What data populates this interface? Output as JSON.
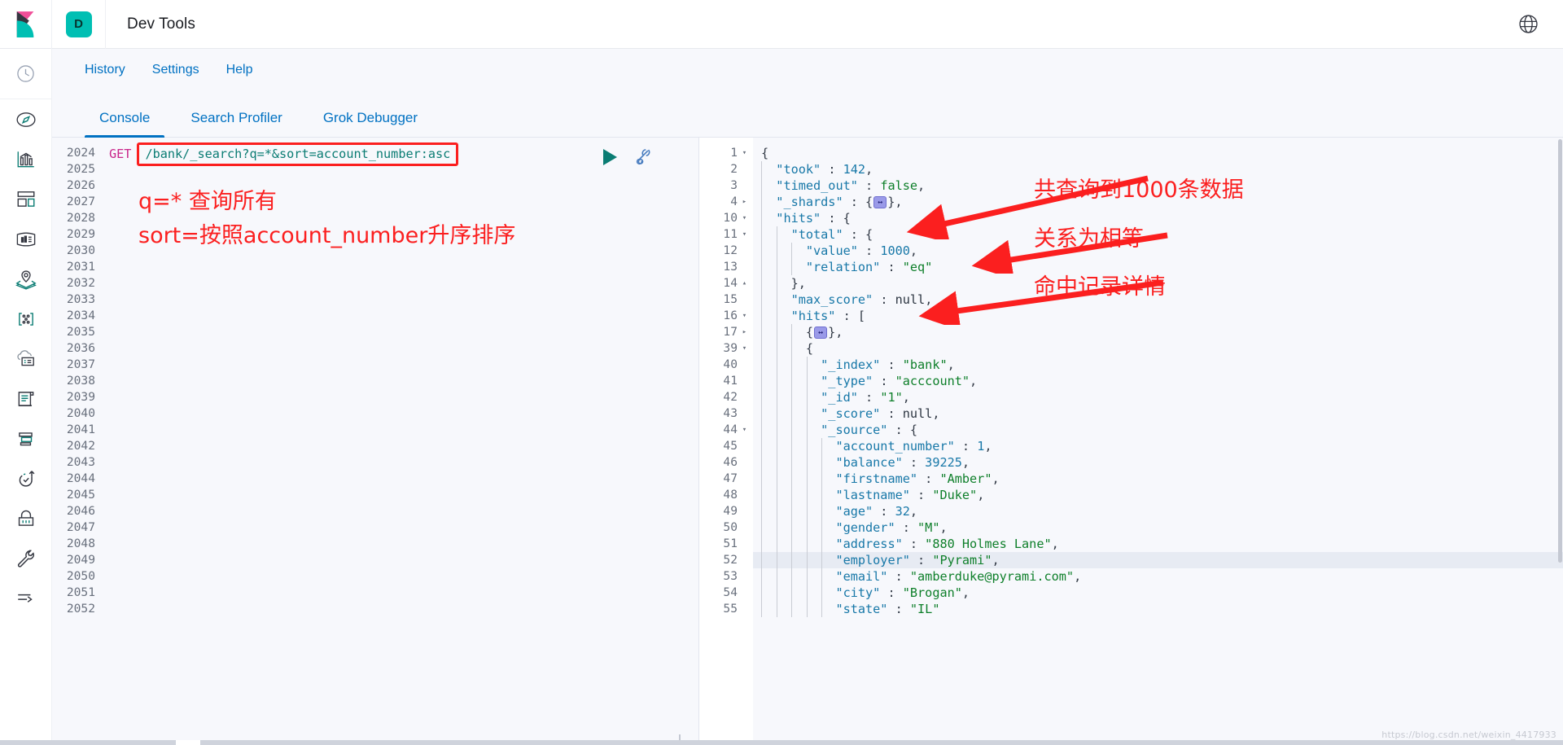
{
  "header": {
    "logo_icon": "kibana-logo",
    "space_letter": "D",
    "title": "Dev Tools",
    "help_icon": "help-circle-icon"
  },
  "sidebar": {
    "items": [
      {
        "icon": "recently-viewed-clock-icon",
        "name": "recently-viewed"
      },
      {
        "icon": "discover-compass-icon",
        "name": "discover"
      },
      {
        "icon": "visualize-chart-icon",
        "name": "visualize"
      },
      {
        "icon": "dashboard-grid-icon",
        "name": "dashboard"
      },
      {
        "icon": "canvas-frame-icon",
        "name": "canvas"
      },
      {
        "icon": "maps-layers-pin-icon",
        "name": "maps"
      },
      {
        "icon": "machine-learning-nodes-icon",
        "name": "machine-learning"
      },
      {
        "icon": "infrastructure-cloud-server-icon",
        "name": "infrastructure"
      },
      {
        "icon": "logs-scroll-icon",
        "name": "logs"
      },
      {
        "icon": "apm-trace-icon",
        "name": "apm"
      },
      {
        "icon": "uptime-check-arrow-icon",
        "name": "uptime"
      },
      {
        "icon": "siem-lock-icon",
        "name": "siem"
      },
      {
        "icon": "dev-tools-wrench-icon",
        "name": "dev-tools"
      },
      {
        "icon": "collapse-arrow-icon",
        "name": "collapse-nav"
      }
    ]
  },
  "topnav": {
    "items": [
      {
        "label": "History",
        "name": "history"
      },
      {
        "label": "Settings",
        "name": "settings"
      },
      {
        "label": "Help",
        "name": "help"
      }
    ]
  },
  "tabs": [
    {
      "label": "Console",
      "active": true
    },
    {
      "label": "Search Profiler",
      "active": false
    },
    {
      "label": "Grok Debugger",
      "active": false
    }
  ],
  "editor": {
    "method": "GET",
    "url": "/bank/_search?q=*&sort=account_number:asc",
    "line_numbers": [
      "2024",
      "2025",
      "2026",
      "2027",
      "2028",
      "2029",
      "2030",
      "2031",
      "2032",
      "2033",
      "2034",
      "2035",
      "2036",
      "2037",
      "2038",
      "2039",
      "2040",
      "2041",
      "2042",
      "2043",
      "2044",
      "2045",
      "2046",
      "2047",
      "2048",
      "2049",
      "2050",
      "2051",
      "2052"
    ],
    "annotation_line_1": "q=* 查询所有",
    "annotation_line_2": "sort=按照account_number升序排序",
    "run_icon": "play-triangle-icon",
    "wrench_icon": "wrench-icon"
  },
  "response": {
    "lines": [
      {
        "num": "1",
        "fold": "down",
        "indent": 0,
        "tokens": [
          {
            "t": "p",
            "v": "{"
          }
        ]
      },
      {
        "num": "2",
        "fold": "",
        "indent": 1,
        "tokens": [
          {
            "t": "k",
            "v": "\"took\""
          },
          {
            "t": "p",
            "v": " : "
          },
          {
            "t": "n",
            "v": "142"
          },
          {
            "t": "p",
            "v": ","
          }
        ]
      },
      {
        "num": "3",
        "fold": "",
        "indent": 1,
        "tokens": [
          {
            "t": "k",
            "v": "\"timed_out\""
          },
          {
            "t": "p",
            "v": " : "
          },
          {
            "t": "s",
            "v": "false"
          },
          {
            "t": "p",
            "v": ","
          }
        ]
      },
      {
        "num": "4",
        "fold": "right",
        "indent": 1,
        "tokens": [
          {
            "t": "k",
            "v": "\"_shards\""
          },
          {
            "t": "p",
            "v": " : {"
          },
          {
            "t": "chip",
            "v": "…"
          },
          {
            "t": "p",
            "v": "},"
          }
        ]
      },
      {
        "num": "10",
        "fold": "down",
        "indent": 1,
        "tokens": [
          {
            "t": "k",
            "v": "\"hits\""
          },
          {
            "t": "p",
            "v": " : {"
          }
        ]
      },
      {
        "num": "11",
        "fold": "down",
        "indent": 2,
        "tokens": [
          {
            "t": "k",
            "v": "\"total\""
          },
          {
            "t": "p",
            "v": " : {"
          }
        ]
      },
      {
        "num": "12",
        "fold": "",
        "indent": 3,
        "tokens": [
          {
            "t": "k",
            "v": "\"value\""
          },
          {
            "t": "p",
            "v": " : "
          },
          {
            "t": "n",
            "v": "1000"
          },
          {
            "t": "p",
            "v": ","
          }
        ]
      },
      {
        "num": "13",
        "fold": "",
        "indent": 3,
        "tokens": [
          {
            "t": "k",
            "v": "\"relation\""
          },
          {
            "t": "p",
            "v": " : "
          },
          {
            "t": "s",
            "v": "\"eq\""
          }
        ]
      },
      {
        "num": "14",
        "fold": "up",
        "indent": 2,
        "tokens": [
          {
            "t": "p",
            "v": "},"
          }
        ]
      },
      {
        "num": "15",
        "fold": "",
        "indent": 2,
        "tokens": [
          {
            "t": "k",
            "v": "\"max_score\""
          },
          {
            "t": "p",
            "v": " : "
          },
          {
            "t": "kw",
            "v": "null"
          },
          {
            "t": "p",
            "v": ","
          }
        ]
      },
      {
        "num": "16",
        "fold": "down",
        "indent": 2,
        "tokens": [
          {
            "t": "k",
            "v": "\"hits\""
          },
          {
            "t": "p",
            "v": " : ["
          }
        ]
      },
      {
        "num": "17",
        "fold": "right",
        "indent": 3,
        "tokens": [
          {
            "t": "p",
            "v": "{"
          },
          {
            "t": "chip",
            "v": "…"
          },
          {
            "t": "p",
            "v": "},"
          }
        ]
      },
      {
        "num": "39",
        "fold": "down",
        "indent": 3,
        "tokens": [
          {
            "t": "p",
            "v": "{"
          }
        ]
      },
      {
        "num": "40",
        "fold": "",
        "indent": 4,
        "tokens": [
          {
            "t": "k",
            "v": "\"_index\""
          },
          {
            "t": "p",
            "v": " : "
          },
          {
            "t": "s",
            "v": "\"bank\""
          },
          {
            "t": "p",
            "v": ","
          }
        ]
      },
      {
        "num": "41",
        "fold": "",
        "indent": 4,
        "tokens": [
          {
            "t": "k",
            "v": "\"_type\""
          },
          {
            "t": "p",
            "v": " : "
          },
          {
            "t": "s",
            "v": "\"acccount\""
          },
          {
            "t": "p",
            "v": ","
          }
        ]
      },
      {
        "num": "42",
        "fold": "",
        "indent": 4,
        "tokens": [
          {
            "t": "k",
            "v": "\"_id\""
          },
          {
            "t": "p",
            "v": " : "
          },
          {
            "t": "s",
            "v": "\"1\""
          },
          {
            "t": "p",
            "v": ","
          }
        ]
      },
      {
        "num": "43",
        "fold": "",
        "indent": 4,
        "tokens": [
          {
            "t": "k",
            "v": "\"_score\""
          },
          {
            "t": "p",
            "v": " : "
          },
          {
            "t": "kw",
            "v": "null"
          },
          {
            "t": "p",
            "v": ","
          }
        ]
      },
      {
        "num": "44",
        "fold": "down",
        "indent": 4,
        "tokens": [
          {
            "t": "k",
            "v": "\"_source\""
          },
          {
            "t": "p",
            "v": " : {"
          }
        ]
      },
      {
        "num": "45",
        "fold": "",
        "indent": 5,
        "tokens": [
          {
            "t": "k",
            "v": "\"account_number\""
          },
          {
            "t": "p",
            "v": " : "
          },
          {
            "t": "n",
            "v": "1"
          },
          {
            "t": "p",
            "v": ","
          }
        ]
      },
      {
        "num": "46",
        "fold": "",
        "indent": 5,
        "tokens": [
          {
            "t": "k",
            "v": "\"balance\""
          },
          {
            "t": "p",
            "v": " : "
          },
          {
            "t": "n",
            "v": "39225"
          },
          {
            "t": "p",
            "v": ","
          }
        ]
      },
      {
        "num": "47",
        "fold": "",
        "indent": 5,
        "tokens": [
          {
            "t": "k",
            "v": "\"firstname\""
          },
          {
            "t": "p",
            "v": " : "
          },
          {
            "t": "s",
            "v": "\"Amber\""
          },
          {
            "t": "p",
            "v": ","
          }
        ]
      },
      {
        "num": "48",
        "fold": "",
        "indent": 5,
        "tokens": [
          {
            "t": "k",
            "v": "\"lastname\""
          },
          {
            "t": "p",
            "v": " : "
          },
          {
            "t": "s",
            "v": "\"Duke\""
          },
          {
            "t": "p",
            "v": ","
          }
        ]
      },
      {
        "num": "49",
        "fold": "",
        "indent": 5,
        "tokens": [
          {
            "t": "k",
            "v": "\"age\""
          },
          {
            "t": "p",
            "v": " : "
          },
          {
            "t": "n",
            "v": "32"
          },
          {
            "t": "p",
            "v": ","
          }
        ]
      },
      {
        "num": "50",
        "fold": "",
        "indent": 5,
        "tokens": [
          {
            "t": "k",
            "v": "\"gender\""
          },
          {
            "t": "p",
            "v": " : "
          },
          {
            "t": "s",
            "v": "\"M\""
          },
          {
            "t": "p",
            "v": ","
          }
        ]
      },
      {
        "num": "51",
        "fold": "",
        "indent": 5,
        "tokens": [
          {
            "t": "k",
            "v": "\"address\""
          },
          {
            "t": "p",
            "v": " : "
          },
          {
            "t": "s",
            "v": "\"880 Holmes Lane\""
          },
          {
            "t": "p",
            "v": ","
          }
        ]
      },
      {
        "num": "52",
        "fold": "",
        "hl": true,
        "indent": 5,
        "tokens": [
          {
            "t": "k",
            "v": "\"employer\""
          },
          {
            "t": "p",
            "v": " : "
          },
          {
            "t": "s",
            "v": "\"Pyrami\""
          },
          {
            "t": "p",
            "v": ","
          }
        ]
      },
      {
        "num": "53",
        "fold": "",
        "indent": 5,
        "tokens": [
          {
            "t": "k",
            "v": "\"email\""
          },
          {
            "t": "p",
            "v": " : "
          },
          {
            "t": "s",
            "v": "\"amberduke@pyrami.com\""
          },
          {
            "t": "p",
            "v": ","
          }
        ]
      },
      {
        "num": "54",
        "fold": "",
        "indent": 5,
        "tokens": [
          {
            "t": "k",
            "v": "\"city\""
          },
          {
            "t": "p",
            "v": " : "
          },
          {
            "t": "s",
            "v": "\"Brogan\""
          },
          {
            "t": "p",
            "v": ","
          }
        ]
      },
      {
        "num": "55",
        "fold": "",
        "indent": 5,
        "tokens": [
          {
            "t": "k",
            "v": "\"state\""
          },
          {
            "t": "p",
            "v": " : "
          },
          {
            "t": "s",
            "v": "\"IL\""
          }
        ]
      }
    ],
    "annotations": [
      {
        "text": "共查询到1000条数据",
        "name": "annotation-total-hits"
      },
      {
        "text": "关系为相等",
        "name": "annotation-relation"
      },
      {
        "text": "命中记录详情",
        "name": "annotation-hits-detail"
      }
    ]
  },
  "watermark": "https://blog.csdn.net/weixin_4417933",
  "colors": {
    "accent": "#0071c2",
    "teal": "#00bfb3",
    "annotation_red": "#fb1f1f",
    "method_pink": "#c9258a",
    "string_green": "#0e7f2a",
    "key_blue": "#1878a8"
  }
}
